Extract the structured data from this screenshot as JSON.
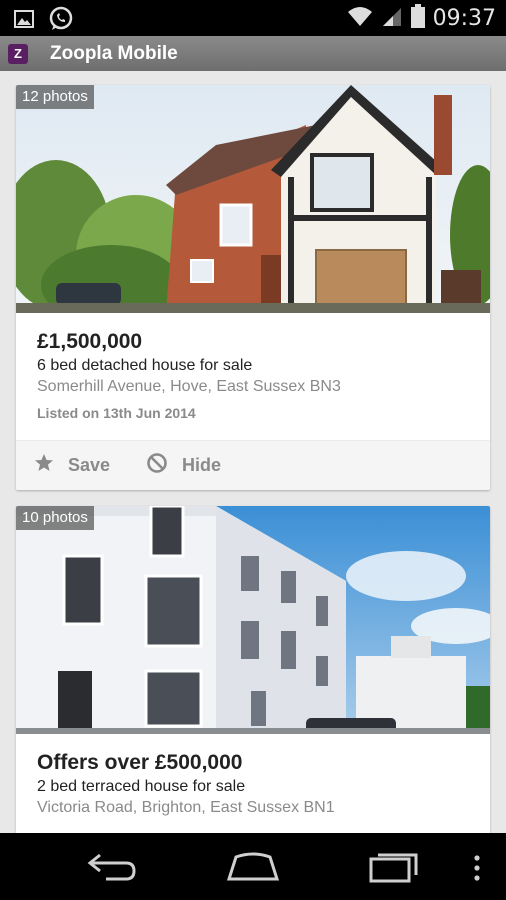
{
  "status_bar": {
    "time": "09:37"
  },
  "app": {
    "title": "Zoopla Mobile",
    "logo_letter": "Z"
  },
  "listings": [
    {
      "photo_count": "12 photos",
      "price": "£1,500,000",
      "description": "6 bed detached house for sale",
      "address": "Somerhill Avenue, Hove, East Sussex BN3",
      "listed": "Listed on 13th Jun 2014",
      "save_label": "Save",
      "hide_label": "Hide"
    },
    {
      "photo_count": "10 photos",
      "price": "Offers over £500,000",
      "description": "2 bed terraced house for sale",
      "address": "Victoria Road, Brighton, East Sussex BN1"
    }
  ],
  "colors": {
    "brand": "#5a1f63",
    "action_bar": "#7b7b7b",
    "muted_text": "#8a8a8a"
  }
}
